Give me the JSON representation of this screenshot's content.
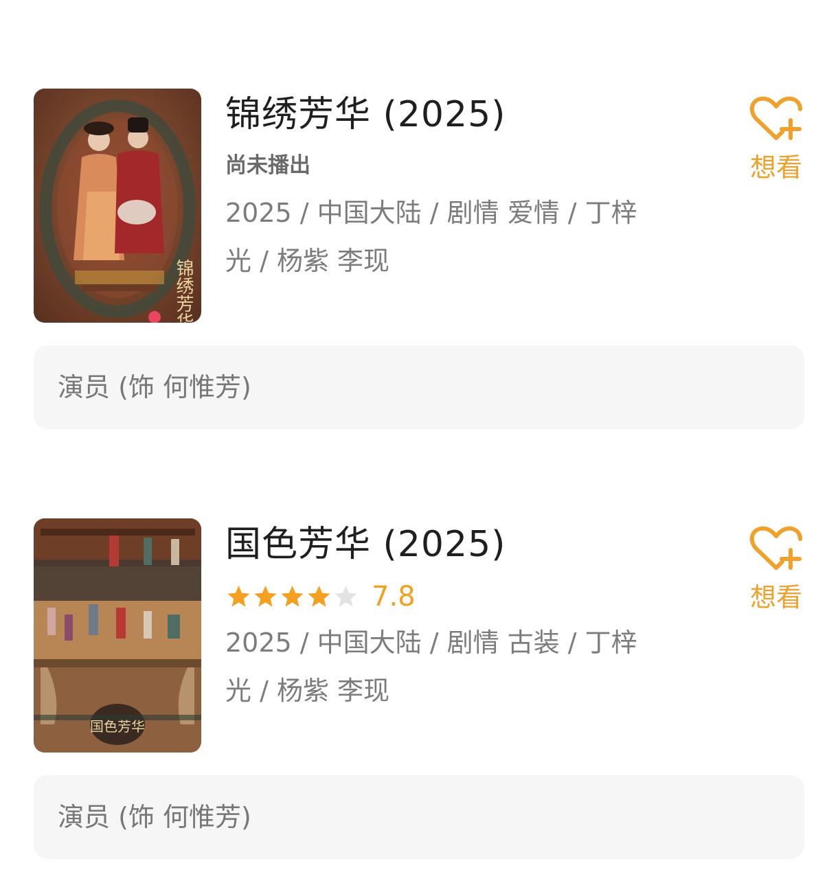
{
  "colors": {
    "accent_orange": "#f0a12b",
    "star_filled": "#f5a020",
    "star_empty": "#e3e3e3",
    "role_box_bg": "#f6f6f6",
    "meta_text": "#7c7c7c"
  },
  "items": [
    {
      "title": "锦绣芳华 (2025)",
      "status": "尚未播出",
      "meta": "2025 / 中国大陆 / 剧情 爱情 / 丁梓光 / 杨紫 李现",
      "want_label": "想看",
      "want_icon": "heart-plus-icon",
      "role": "演员 (饰 何惟芳)",
      "poster_text": "锦绣芳华"
    },
    {
      "title": "国色芳华 (2025)",
      "rating": {
        "stars_filled": 4,
        "stars_total": 5,
        "score": "7.8"
      },
      "meta": "2025 / 中国大陆 / 剧情 古装 / 丁梓光 / 杨紫 李现",
      "want_label": "想看",
      "want_icon": "heart-plus-icon",
      "role": "演员 (饰 何惟芳)",
      "poster_text": "国色芳华"
    }
  ]
}
